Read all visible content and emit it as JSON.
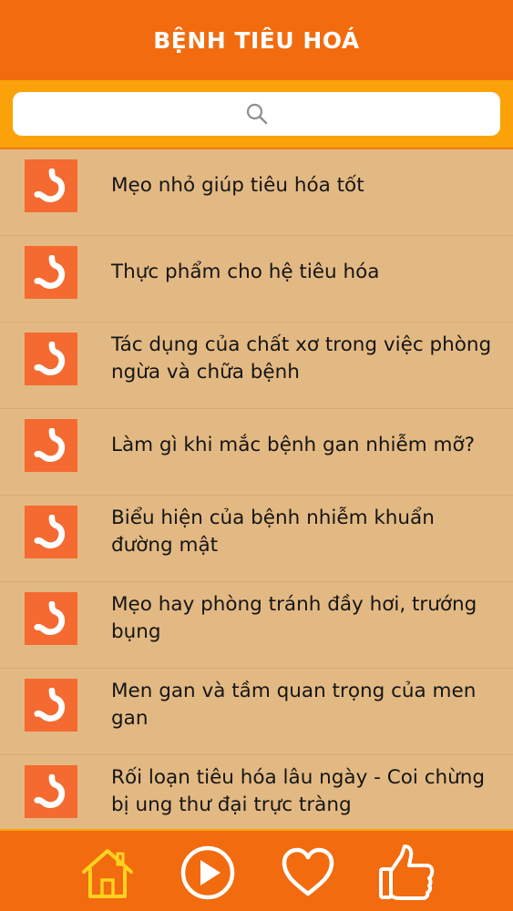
{
  "header": {
    "title": "BỆNH TIÊU HOÁ"
  },
  "search": {
    "value": "",
    "icon": "search-icon"
  },
  "articles": [
    {
      "title": "Mẹo nhỏ giúp tiêu hóa tốt",
      "icon": "stomach-icon"
    },
    {
      "title": "Thực phẩm cho hệ tiêu hóa",
      "icon": "stomach-icon"
    },
    {
      "title": "Tác dụng của chất xơ trong việc phòng ngừa và chữa bệnh",
      "icon": "stomach-icon"
    },
    {
      "title": "Làm gì khi mắc bệnh gan nhiễm mỡ?",
      "icon": "stomach-icon"
    },
    {
      "title": "Biểu hiện của bệnh nhiễm khuẩn đường mật",
      "icon": "stomach-icon"
    },
    {
      "title": "Mẹo hay phòng tránh đầy hơi, trướng bụng",
      "icon": "stomach-icon"
    },
    {
      "title": "Men gan và tầm quan trọng của men gan",
      "icon": "stomach-icon"
    },
    {
      "title": "Rối loạn tiêu hóa lâu ngày - Coi chừng bị ung thư đại trực tràng",
      "icon": "stomach-icon"
    }
  ],
  "tabbar": {
    "items": [
      {
        "icon": "home-icon",
        "active": true
      },
      {
        "icon": "play-icon",
        "active": false
      },
      {
        "icon": "heart-icon",
        "active": false
      },
      {
        "icon": "thumbs-up-icon",
        "active": false
      }
    ]
  },
  "colors": {
    "header": "#f26b0f",
    "search_bar": "#fba20a",
    "list_background": "#e3b983",
    "thumbnail": "#f46a31",
    "active_tab": "#ffd21f",
    "inactive_tab": "#ffffff"
  }
}
